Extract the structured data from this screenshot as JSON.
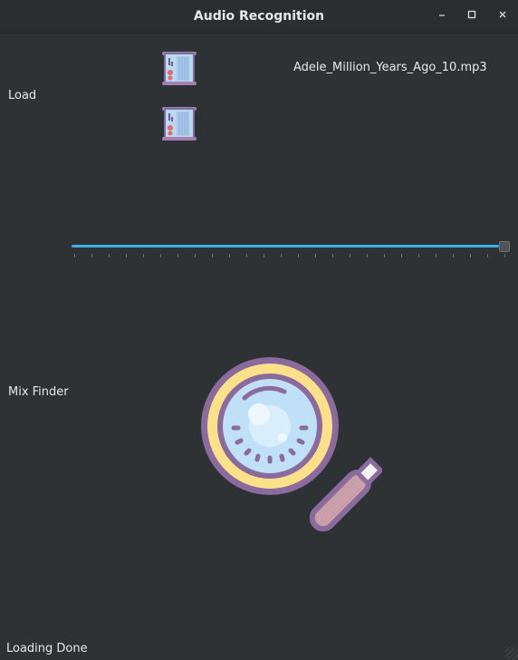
{
  "window": {
    "title": "Audio Recognition",
    "minimize_glyph": "–",
    "maximize_glyph": "□",
    "close_glyph": "×"
  },
  "load": {
    "label": "Load",
    "filename": "Adele_Million_Years_Ago_10.mp3",
    "buttons": [
      {
        "icon": "audio-mixer-icon"
      },
      {
        "icon": "audio-mixer-icon"
      }
    ]
  },
  "progress": {
    "value": 1.0,
    "tick_count": 26
  },
  "mix_finder": {
    "label": "Mix Finder",
    "icon": "magnifier-icon"
  },
  "status": {
    "text": "Loading Done"
  },
  "colors": {
    "accent": "#3daee9",
    "background": "#2e3235",
    "magnifier_frame": "#8b6a9e",
    "magnifier_ring": "#fde08a",
    "magnifier_glass": "#bfe0f7"
  }
}
